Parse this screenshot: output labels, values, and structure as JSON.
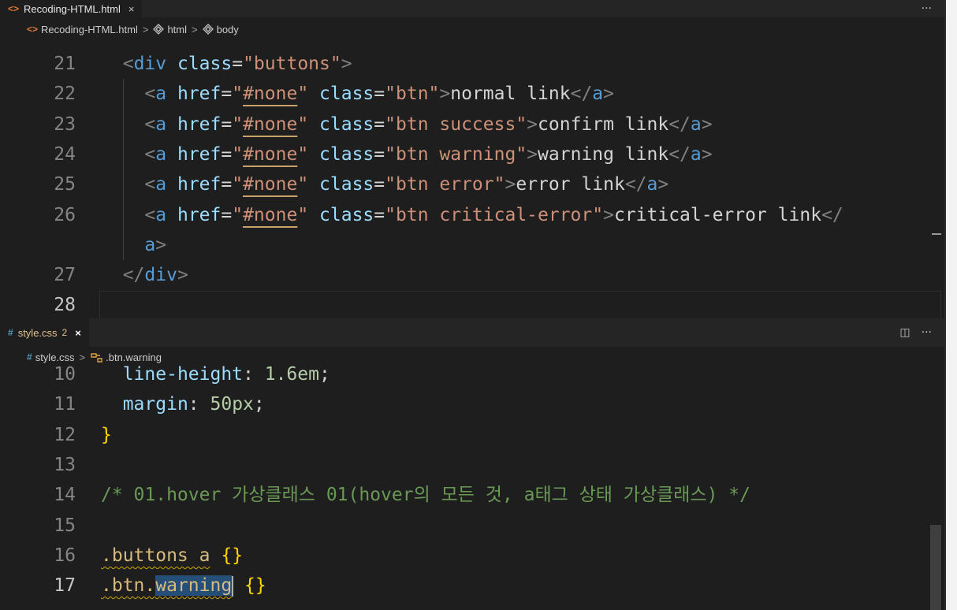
{
  "top_editor": {
    "tab": {
      "icon": "<>",
      "filename": "Recoding-HTML.html",
      "close": "×"
    },
    "actions": {
      "more": "···"
    },
    "breadcrumb": {
      "icon": "<>",
      "file": "Recoding-HTML.html",
      "item1": "html",
      "item2": "body",
      "sep": ">"
    },
    "lines": [
      {
        "num": "21",
        "tokens": [
          [
            "plain",
            "  "
          ],
          [
            "tag",
            "<"
          ],
          [
            "tn",
            "div"
          ],
          [
            "plain",
            " "
          ],
          [
            "an",
            "class"
          ],
          [
            "plain",
            "="
          ],
          [
            "av",
            "\"buttons\""
          ],
          [
            "tag",
            ">"
          ]
        ]
      },
      {
        "num": "22",
        "tokens": [
          [
            "plain",
            "    "
          ],
          [
            "tag",
            "<"
          ],
          [
            "tn",
            "a"
          ],
          [
            "plain",
            " "
          ],
          [
            "an",
            "href"
          ],
          [
            "plain",
            "="
          ],
          [
            "av",
            "\""
          ],
          [
            "avu",
            "#none"
          ],
          [
            "av",
            "\""
          ],
          [
            "plain",
            " "
          ],
          [
            "an",
            "class"
          ],
          [
            "plain",
            "="
          ],
          [
            "av",
            "\"btn\""
          ],
          [
            "tag",
            ">"
          ],
          [
            "plain",
            "normal link"
          ],
          [
            "tag",
            "</"
          ],
          [
            "tn",
            "a"
          ],
          [
            "tag",
            ">"
          ]
        ]
      },
      {
        "num": "23",
        "tokens": [
          [
            "plain",
            "    "
          ],
          [
            "tag",
            "<"
          ],
          [
            "tn",
            "a"
          ],
          [
            "plain",
            " "
          ],
          [
            "an",
            "href"
          ],
          [
            "plain",
            "="
          ],
          [
            "av",
            "\""
          ],
          [
            "avu",
            "#none"
          ],
          [
            "av",
            "\""
          ],
          [
            "plain",
            " "
          ],
          [
            "an",
            "class"
          ],
          [
            "plain",
            "="
          ],
          [
            "av",
            "\"btn success\""
          ],
          [
            "tag",
            ">"
          ],
          [
            "plain",
            "confirm link"
          ],
          [
            "tag",
            "</"
          ],
          [
            "tn",
            "a"
          ],
          [
            "tag",
            ">"
          ]
        ]
      },
      {
        "num": "24",
        "tokens": [
          [
            "plain",
            "    "
          ],
          [
            "tag",
            "<"
          ],
          [
            "tn",
            "a"
          ],
          [
            "plain",
            " "
          ],
          [
            "an",
            "href"
          ],
          [
            "plain",
            "="
          ],
          [
            "av",
            "\""
          ],
          [
            "avu",
            "#none"
          ],
          [
            "av",
            "\""
          ],
          [
            "plain",
            " "
          ],
          [
            "an",
            "class"
          ],
          [
            "plain",
            "="
          ],
          [
            "av",
            "\"btn warning\""
          ],
          [
            "tag",
            ">"
          ],
          [
            "plain",
            "warning link"
          ],
          [
            "tag",
            "</"
          ],
          [
            "tn",
            "a"
          ],
          [
            "tag",
            ">"
          ]
        ]
      },
      {
        "num": "25",
        "tokens": [
          [
            "plain",
            "    "
          ],
          [
            "tag",
            "<"
          ],
          [
            "tn",
            "a"
          ],
          [
            "plain",
            " "
          ],
          [
            "an",
            "href"
          ],
          [
            "plain",
            "="
          ],
          [
            "av",
            "\""
          ],
          [
            "avu",
            "#none"
          ],
          [
            "av",
            "\""
          ],
          [
            "plain",
            " "
          ],
          [
            "an",
            "class"
          ],
          [
            "plain",
            "="
          ],
          [
            "av",
            "\"btn error\""
          ],
          [
            "tag",
            ">"
          ],
          [
            "plain",
            "error link"
          ],
          [
            "tag",
            "</"
          ],
          [
            "tn",
            "a"
          ],
          [
            "tag",
            ">"
          ]
        ]
      },
      {
        "num": "26",
        "tokens": [
          [
            "plain",
            "    "
          ],
          [
            "tag",
            "<"
          ],
          [
            "tn",
            "a"
          ],
          [
            "plain",
            " "
          ],
          [
            "an",
            "href"
          ],
          [
            "plain",
            "="
          ],
          [
            "av",
            "\""
          ],
          [
            "avu",
            "#none"
          ],
          [
            "av",
            "\""
          ],
          [
            "plain",
            " "
          ],
          [
            "an",
            "class"
          ],
          [
            "plain",
            "="
          ],
          [
            "av",
            "\"btn critical-error\""
          ],
          [
            "tag",
            ">"
          ],
          [
            "plain",
            "critical-error link"
          ],
          [
            "tag",
            "</"
          ]
        ]
      },
      {
        "num": "",
        "tokens": [
          [
            "plain",
            "    "
          ],
          [
            "tn",
            "a"
          ],
          [
            "tag",
            ">"
          ]
        ]
      },
      {
        "num": "27",
        "tokens": [
          [
            "plain",
            "  "
          ],
          [
            "tag",
            "</"
          ],
          [
            "tn",
            "div"
          ],
          [
            "tag",
            ">"
          ]
        ]
      },
      {
        "num": "28",
        "tokens": []
      }
    ]
  },
  "bottom_editor": {
    "tab": {
      "icon": "#",
      "filename": "style.css",
      "badge": "2",
      "close": "×"
    },
    "actions": {
      "split": "◫",
      "more": "···"
    },
    "breadcrumb": {
      "icon": "#",
      "file": "style.css",
      "item1": ".btn.warning",
      "sep": ">"
    },
    "lines": [
      {
        "num": "10",
        "tokens": [
          [
            "plain",
            "  "
          ],
          [
            "prop",
            "line-height"
          ],
          [
            "plain",
            ": "
          ],
          [
            "num",
            "1.6em"
          ],
          [
            "plain",
            ";"
          ]
        ]
      },
      {
        "num": "11",
        "tokens": [
          [
            "plain",
            "  "
          ],
          [
            "prop",
            "margin"
          ],
          [
            "plain",
            ": "
          ],
          [
            "num",
            "50px"
          ],
          [
            "plain",
            ";"
          ]
        ]
      },
      {
        "num": "12",
        "tokens": [
          [
            "brace",
            "}"
          ]
        ]
      },
      {
        "num": "13",
        "tokens": []
      },
      {
        "num": "14",
        "tokens": [
          [
            "cm",
            "/* 01.hover 가상클래스 01(hover의 모든 것, a태그 상태 가상클래스) */"
          ]
        ]
      },
      {
        "num": "15",
        "tokens": []
      },
      {
        "num": "16",
        "tokens": [
          [
            "selw",
            ".buttons a"
          ],
          [
            "plain",
            " "
          ],
          [
            "brace",
            "{}"
          ]
        ]
      },
      {
        "num": "17",
        "tokens": [
          [
            "selw",
            ".btn."
          ],
          [
            "selhl",
            "warning"
          ],
          [
            "cursor",
            ""
          ],
          [
            "plain",
            " "
          ],
          [
            "brace",
            "{}"
          ]
        ]
      }
    ]
  }
}
